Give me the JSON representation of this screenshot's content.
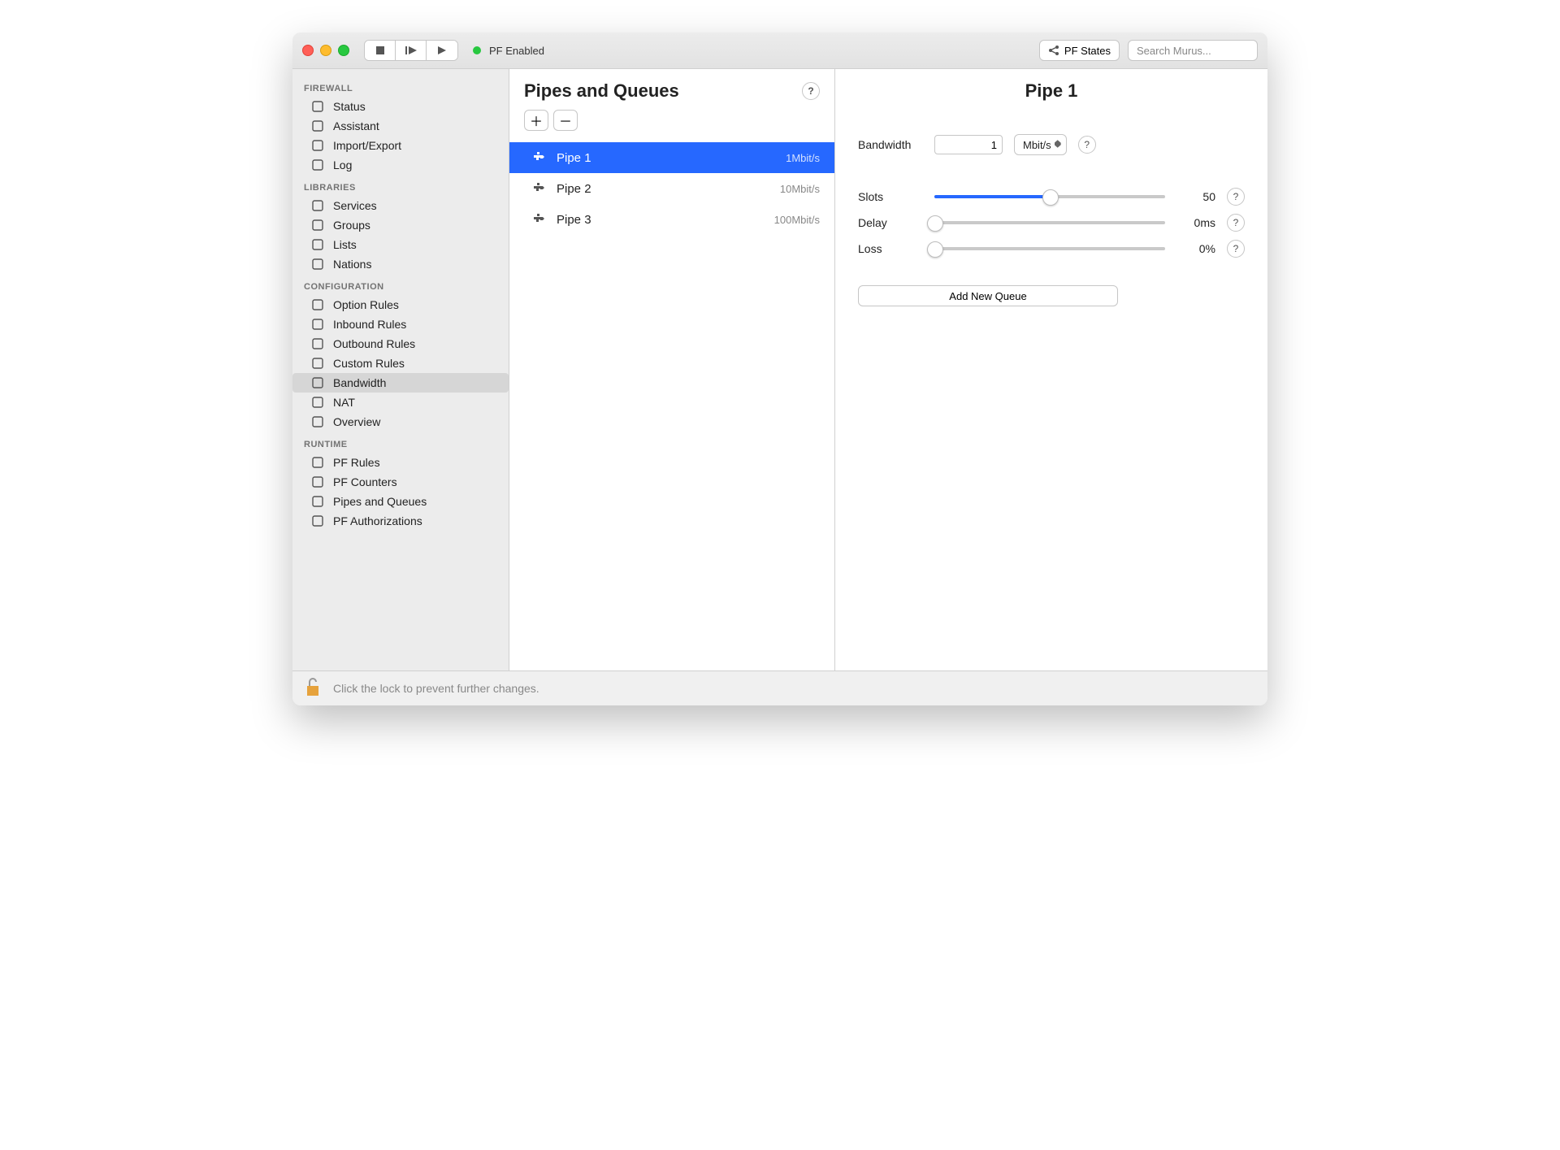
{
  "toolbar": {
    "status_label": "PF Enabled",
    "states_button": "PF States",
    "search_placeholder": "Search Murus..."
  },
  "sidebar": {
    "sections": [
      {
        "heading": "FIREWALL",
        "items": [
          {
            "label": "Status",
            "selected": false
          },
          {
            "label": "Assistant",
            "selected": false
          },
          {
            "label": "Import/Export",
            "selected": false
          },
          {
            "label": "Log",
            "selected": false
          }
        ]
      },
      {
        "heading": "LIBRARIES",
        "items": [
          {
            "label": "Services",
            "selected": false
          },
          {
            "label": "Groups",
            "selected": false
          },
          {
            "label": "Lists",
            "selected": false
          },
          {
            "label": "Nations",
            "selected": false
          }
        ]
      },
      {
        "heading": "CONFIGURATION",
        "items": [
          {
            "label": "Option Rules",
            "selected": false
          },
          {
            "label": "Inbound Rules",
            "selected": false
          },
          {
            "label": "Outbound Rules",
            "selected": false
          },
          {
            "label": "Custom Rules",
            "selected": false
          },
          {
            "label": "Bandwidth",
            "selected": true
          },
          {
            "label": "NAT",
            "selected": false
          },
          {
            "label": "Overview",
            "selected": false
          }
        ]
      },
      {
        "heading": "RUNTIME",
        "items": [
          {
            "label": "PF Rules",
            "selected": false
          },
          {
            "label": "PF Counters",
            "selected": false
          },
          {
            "label": "Pipes and Queues",
            "selected": false
          },
          {
            "label": "PF Authorizations",
            "selected": false
          }
        ]
      }
    ]
  },
  "mid": {
    "title": "Pipes and Queues",
    "pipes": [
      {
        "name": "Pipe 1",
        "bandwidth": "1Mbit/s",
        "selected": true
      },
      {
        "name": "Pipe 2",
        "bandwidth": "10Mbit/s",
        "selected": false
      },
      {
        "name": "Pipe 3",
        "bandwidth": "100Mbit/s",
        "selected": false
      }
    ]
  },
  "detail": {
    "title": "Pipe 1",
    "bandwidth_label": "Bandwidth",
    "bandwidth_value": "1",
    "bandwidth_unit": "Mbit/s",
    "slots_label": "Slots",
    "slots_value": "50",
    "slots_percent": 50,
    "delay_label": "Delay",
    "delay_value": "0ms",
    "delay_percent": 0,
    "loss_label": "Loss",
    "loss_value": "0%",
    "loss_percent": 0,
    "add_queue_label": "Add New Queue"
  },
  "footer": {
    "lock_label": "Click the lock to prevent further changes."
  }
}
